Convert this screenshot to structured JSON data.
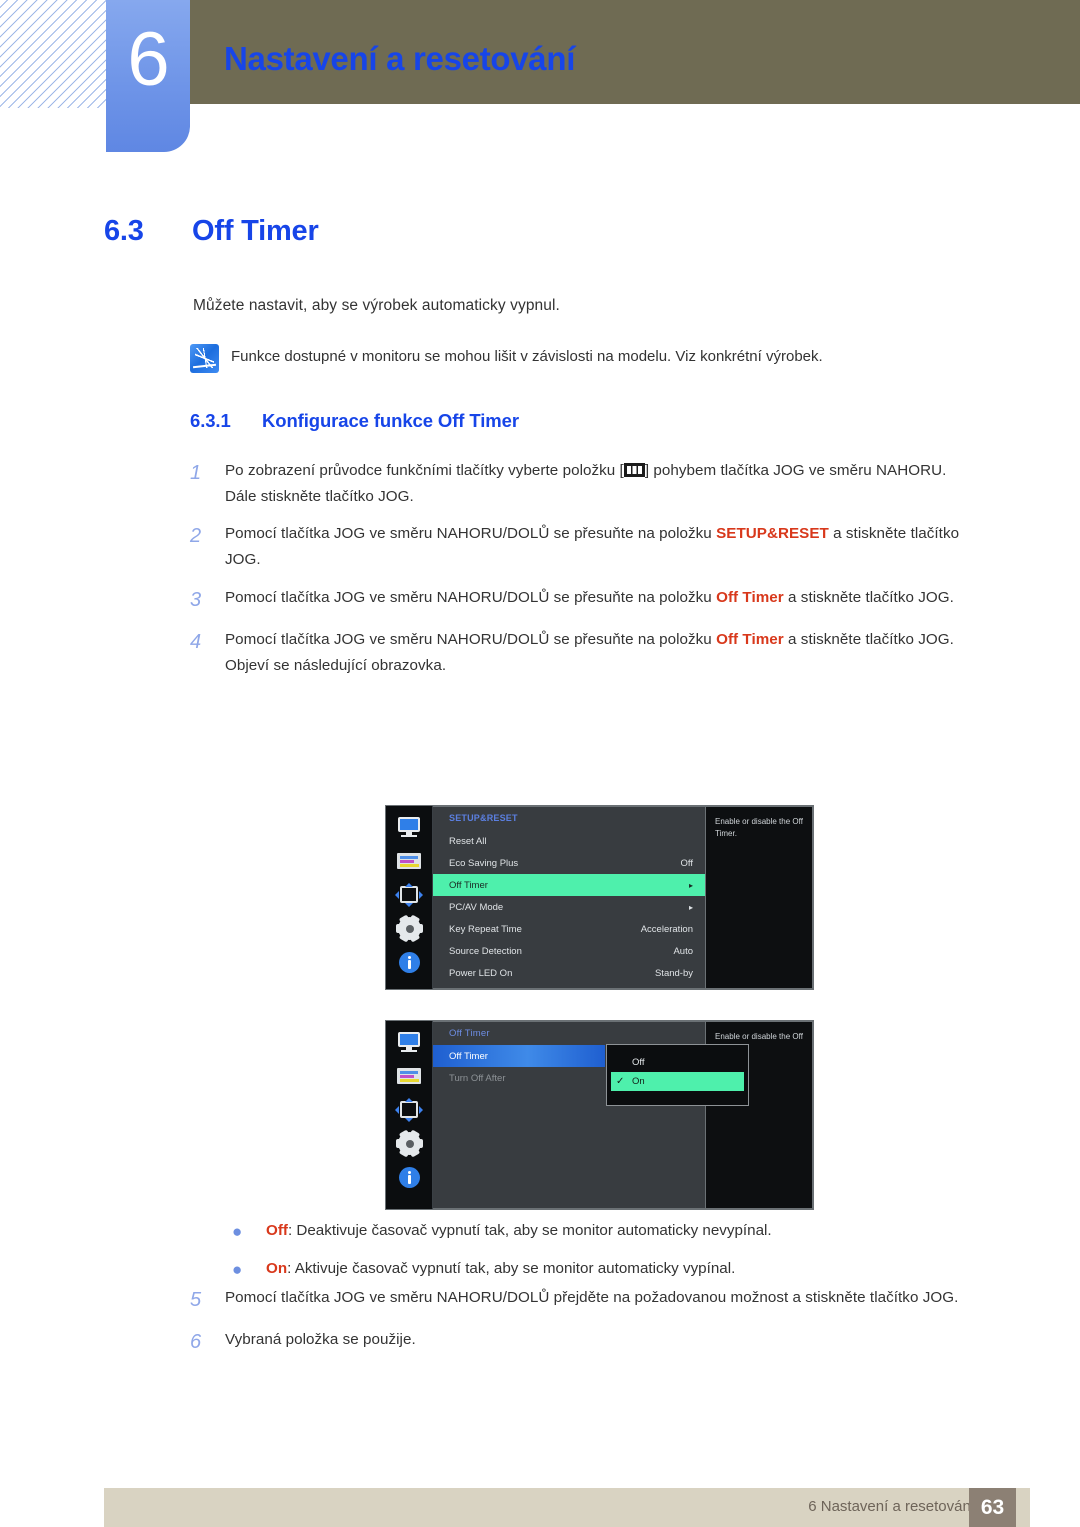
{
  "header": {
    "chapter_number": "6",
    "chapter_title": "Nastavení a resetování"
  },
  "section": {
    "number": "6.3",
    "title": "Off Timer",
    "intro": "Můžete nastavit, aby se výrobek automaticky vypnul.",
    "note": "Funkce dostupné v monitoru se mohou lišit v závislosti na modelu. Viz konkrétní výrobek."
  },
  "subsection": {
    "number": "6.3.1",
    "title": "Konfigurace funkce Off Timer"
  },
  "steps": [
    {
      "num": "1",
      "text_before": "Po zobrazení průvodce funkčními tlačítky vyberte položku [",
      "text_after": "] pohybem tlačítka JOG ve směru NAHORU.",
      "extra": "Dále stiskněte tlačítko JOG."
    },
    {
      "num": "2",
      "text_before": "Pomocí tlačítka JOG ve směru NAHORU/DOLŮ se přesuňte na položku ",
      "keyword": "SETUP&RESET",
      "text_after": " a stiskněte tlačítko JOG."
    },
    {
      "num": "3",
      "text_before": "Pomocí tlačítka JOG ve směru NAHORU/DOLŮ se přesuňte na položku ",
      "keyword": "Off Timer",
      "text_after": " a stiskněte tlačítko JOG."
    },
    {
      "num": "4",
      "text_before": "Pomocí tlačítka JOG ve směru NAHORU/DOLŮ se přesuňte na položku ",
      "keyword": "Off Timer",
      "text_after": " a stiskněte tlačítko JOG.",
      "extra": "Objeví se následující obrazovka."
    }
  ],
  "bullets": [
    {
      "keyword": "Off",
      "text": ": Deaktivuje časovač vypnutí tak, aby se monitor automaticky nevypínal."
    },
    {
      "keyword": "On",
      "text": ": Aktivuje časovač vypnutí tak, aby se monitor automaticky vypínal."
    }
  ],
  "steps2": [
    {
      "num": "5",
      "text": "Pomocí tlačítka JOG ve směru NAHORU/DOLŮ přejděte na požadovanou možnost a stiskněte tlačítko JOG."
    },
    {
      "num": "6",
      "text": "Vybraná položka se použije."
    }
  ],
  "osd1": {
    "heading": "SETUP&RESET",
    "description": "Enable or disable the Off Timer.",
    "rail_icons": [
      "monitor-icon",
      "picture-icon",
      "position-icon",
      "gear-icon",
      "info-icon"
    ],
    "rows": [
      {
        "label": "Reset All",
        "value": ""
      },
      {
        "label": "Eco Saving Plus",
        "value": "Off"
      },
      {
        "label": "Off Timer",
        "value": "▸",
        "selected": true
      },
      {
        "label": "PC/AV Mode",
        "value": "▸"
      },
      {
        "label": "Key Repeat Time",
        "value": "Acceleration"
      },
      {
        "label": "Source Detection",
        "value": "Auto"
      },
      {
        "label": "Power LED On",
        "value": "Stand-by"
      }
    ]
  },
  "osd2": {
    "heading": "Off Timer",
    "description": "Enable or disable the Off Timer.",
    "rows": [
      {
        "label": "Off Timer",
        "selected": true
      },
      {
        "label": "Turn Off After",
        "dim": true
      }
    ],
    "popup": [
      {
        "label": "Off",
        "check": "",
        "on": false
      },
      {
        "label": "On",
        "check": "✓",
        "on": true
      }
    ]
  },
  "footer": {
    "text": "6 Nastavení a resetování",
    "page": "63"
  },
  "colors": {
    "accent_blue": "#1745e8",
    "keyword_red": "#d8381b",
    "olive": "#6f6b53",
    "footer_beige": "#d9d3c2",
    "footer_page_box": "#8c8074",
    "osd_green": "#4ef0ac"
  }
}
